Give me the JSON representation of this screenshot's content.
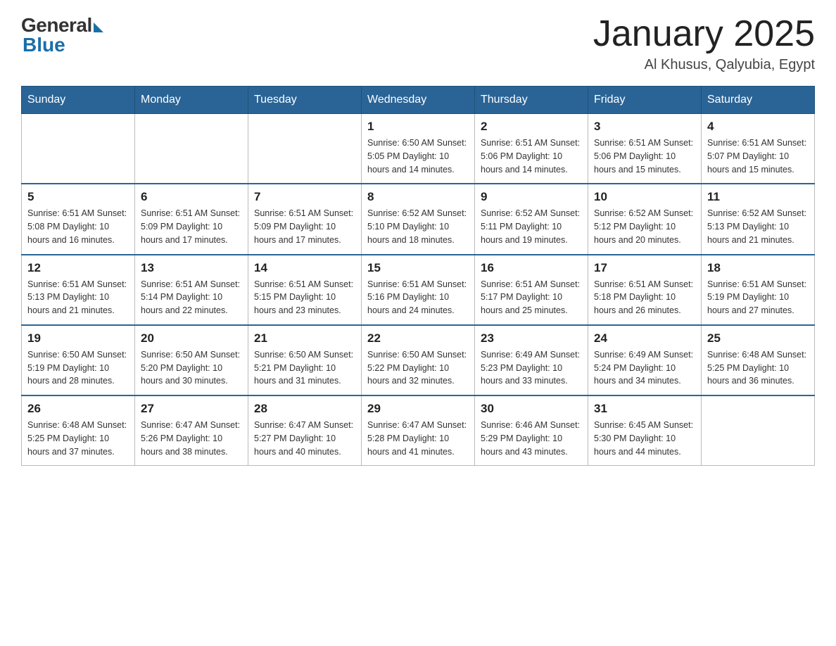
{
  "header": {
    "logo_general": "General",
    "logo_blue": "Blue",
    "month_title": "January 2025",
    "location": "Al Khusus, Qalyubia, Egypt"
  },
  "days_of_week": [
    "Sunday",
    "Monday",
    "Tuesday",
    "Wednesday",
    "Thursday",
    "Friday",
    "Saturday"
  ],
  "weeks": [
    [
      {
        "day": "",
        "info": ""
      },
      {
        "day": "",
        "info": ""
      },
      {
        "day": "",
        "info": ""
      },
      {
        "day": "1",
        "info": "Sunrise: 6:50 AM\nSunset: 5:05 PM\nDaylight: 10 hours\nand 14 minutes."
      },
      {
        "day": "2",
        "info": "Sunrise: 6:51 AM\nSunset: 5:06 PM\nDaylight: 10 hours\nand 14 minutes."
      },
      {
        "day": "3",
        "info": "Sunrise: 6:51 AM\nSunset: 5:06 PM\nDaylight: 10 hours\nand 15 minutes."
      },
      {
        "day": "4",
        "info": "Sunrise: 6:51 AM\nSunset: 5:07 PM\nDaylight: 10 hours\nand 15 minutes."
      }
    ],
    [
      {
        "day": "5",
        "info": "Sunrise: 6:51 AM\nSunset: 5:08 PM\nDaylight: 10 hours\nand 16 minutes."
      },
      {
        "day": "6",
        "info": "Sunrise: 6:51 AM\nSunset: 5:09 PM\nDaylight: 10 hours\nand 17 minutes."
      },
      {
        "day": "7",
        "info": "Sunrise: 6:51 AM\nSunset: 5:09 PM\nDaylight: 10 hours\nand 17 minutes."
      },
      {
        "day": "8",
        "info": "Sunrise: 6:52 AM\nSunset: 5:10 PM\nDaylight: 10 hours\nand 18 minutes."
      },
      {
        "day": "9",
        "info": "Sunrise: 6:52 AM\nSunset: 5:11 PM\nDaylight: 10 hours\nand 19 minutes."
      },
      {
        "day": "10",
        "info": "Sunrise: 6:52 AM\nSunset: 5:12 PM\nDaylight: 10 hours\nand 20 minutes."
      },
      {
        "day": "11",
        "info": "Sunrise: 6:52 AM\nSunset: 5:13 PM\nDaylight: 10 hours\nand 21 minutes."
      }
    ],
    [
      {
        "day": "12",
        "info": "Sunrise: 6:51 AM\nSunset: 5:13 PM\nDaylight: 10 hours\nand 21 minutes."
      },
      {
        "day": "13",
        "info": "Sunrise: 6:51 AM\nSunset: 5:14 PM\nDaylight: 10 hours\nand 22 minutes."
      },
      {
        "day": "14",
        "info": "Sunrise: 6:51 AM\nSunset: 5:15 PM\nDaylight: 10 hours\nand 23 minutes."
      },
      {
        "day": "15",
        "info": "Sunrise: 6:51 AM\nSunset: 5:16 PM\nDaylight: 10 hours\nand 24 minutes."
      },
      {
        "day": "16",
        "info": "Sunrise: 6:51 AM\nSunset: 5:17 PM\nDaylight: 10 hours\nand 25 minutes."
      },
      {
        "day": "17",
        "info": "Sunrise: 6:51 AM\nSunset: 5:18 PM\nDaylight: 10 hours\nand 26 minutes."
      },
      {
        "day": "18",
        "info": "Sunrise: 6:51 AM\nSunset: 5:19 PM\nDaylight: 10 hours\nand 27 minutes."
      }
    ],
    [
      {
        "day": "19",
        "info": "Sunrise: 6:50 AM\nSunset: 5:19 PM\nDaylight: 10 hours\nand 28 minutes."
      },
      {
        "day": "20",
        "info": "Sunrise: 6:50 AM\nSunset: 5:20 PM\nDaylight: 10 hours\nand 30 minutes."
      },
      {
        "day": "21",
        "info": "Sunrise: 6:50 AM\nSunset: 5:21 PM\nDaylight: 10 hours\nand 31 minutes."
      },
      {
        "day": "22",
        "info": "Sunrise: 6:50 AM\nSunset: 5:22 PM\nDaylight: 10 hours\nand 32 minutes."
      },
      {
        "day": "23",
        "info": "Sunrise: 6:49 AM\nSunset: 5:23 PM\nDaylight: 10 hours\nand 33 minutes."
      },
      {
        "day": "24",
        "info": "Sunrise: 6:49 AM\nSunset: 5:24 PM\nDaylight: 10 hours\nand 34 minutes."
      },
      {
        "day": "25",
        "info": "Sunrise: 6:48 AM\nSunset: 5:25 PM\nDaylight: 10 hours\nand 36 minutes."
      }
    ],
    [
      {
        "day": "26",
        "info": "Sunrise: 6:48 AM\nSunset: 5:25 PM\nDaylight: 10 hours\nand 37 minutes."
      },
      {
        "day": "27",
        "info": "Sunrise: 6:47 AM\nSunset: 5:26 PM\nDaylight: 10 hours\nand 38 minutes."
      },
      {
        "day": "28",
        "info": "Sunrise: 6:47 AM\nSunset: 5:27 PM\nDaylight: 10 hours\nand 40 minutes."
      },
      {
        "day": "29",
        "info": "Sunrise: 6:47 AM\nSunset: 5:28 PM\nDaylight: 10 hours\nand 41 minutes."
      },
      {
        "day": "30",
        "info": "Sunrise: 6:46 AM\nSunset: 5:29 PM\nDaylight: 10 hours\nand 43 minutes."
      },
      {
        "day": "31",
        "info": "Sunrise: 6:45 AM\nSunset: 5:30 PM\nDaylight: 10 hours\nand 44 minutes."
      },
      {
        "day": "",
        "info": ""
      }
    ]
  ]
}
